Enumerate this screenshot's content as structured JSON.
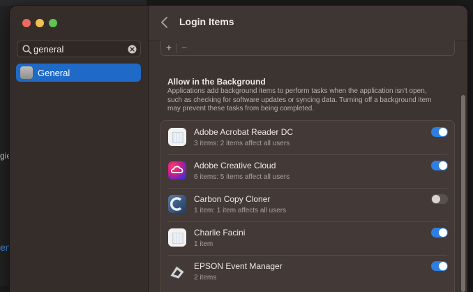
{
  "background": {
    "fragment_left_1": "gie",
    "fragment_left_2": "en"
  },
  "sidebar": {
    "search": {
      "value": "general",
      "placeholder": "Search"
    },
    "items": [
      {
        "label": "General",
        "selected": true
      }
    ]
  },
  "header": {
    "title": "Login Items"
  },
  "toolbar": {
    "add": "+",
    "remove": "−"
  },
  "section": {
    "title": "Allow in the Background",
    "description": "Applications add background items to perform tasks when the application isn't open, such as checking for software updates or syncing data. Turning off a background item may prevent these tasks from being completed."
  },
  "apps": [
    {
      "name": "Adobe Acrobat Reader DC",
      "detail": "3 items: 2 items affect all users",
      "enabled": true,
      "icon": "blank-app-icon"
    },
    {
      "name": "Adobe Creative Cloud",
      "detail": "6 items: 5 items affect all users",
      "enabled": true,
      "icon": "creative-cloud-icon"
    },
    {
      "name": "Carbon Copy Cloner",
      "detail": "1 item: 1 item affects all users",
      "enabled": false,
      "icon": "carbon-copy-cloner-icon"
    },
    {
      "name": "Charlie Facini",
      "detail": "1 item",
      "enabled": true,
      "icon": "blank-app-icon"
    },
    {
      "name": "EPSON Event Manager",
      "detail": "2 items",
      "enabled": true,
      "icon": "epson-scanner-icon"
    }
  ],
  "colors": {
    "accent": "#2f7fe0",
    "selection": "#1f69c7",
    "window": "#3c3431"
  }
}
